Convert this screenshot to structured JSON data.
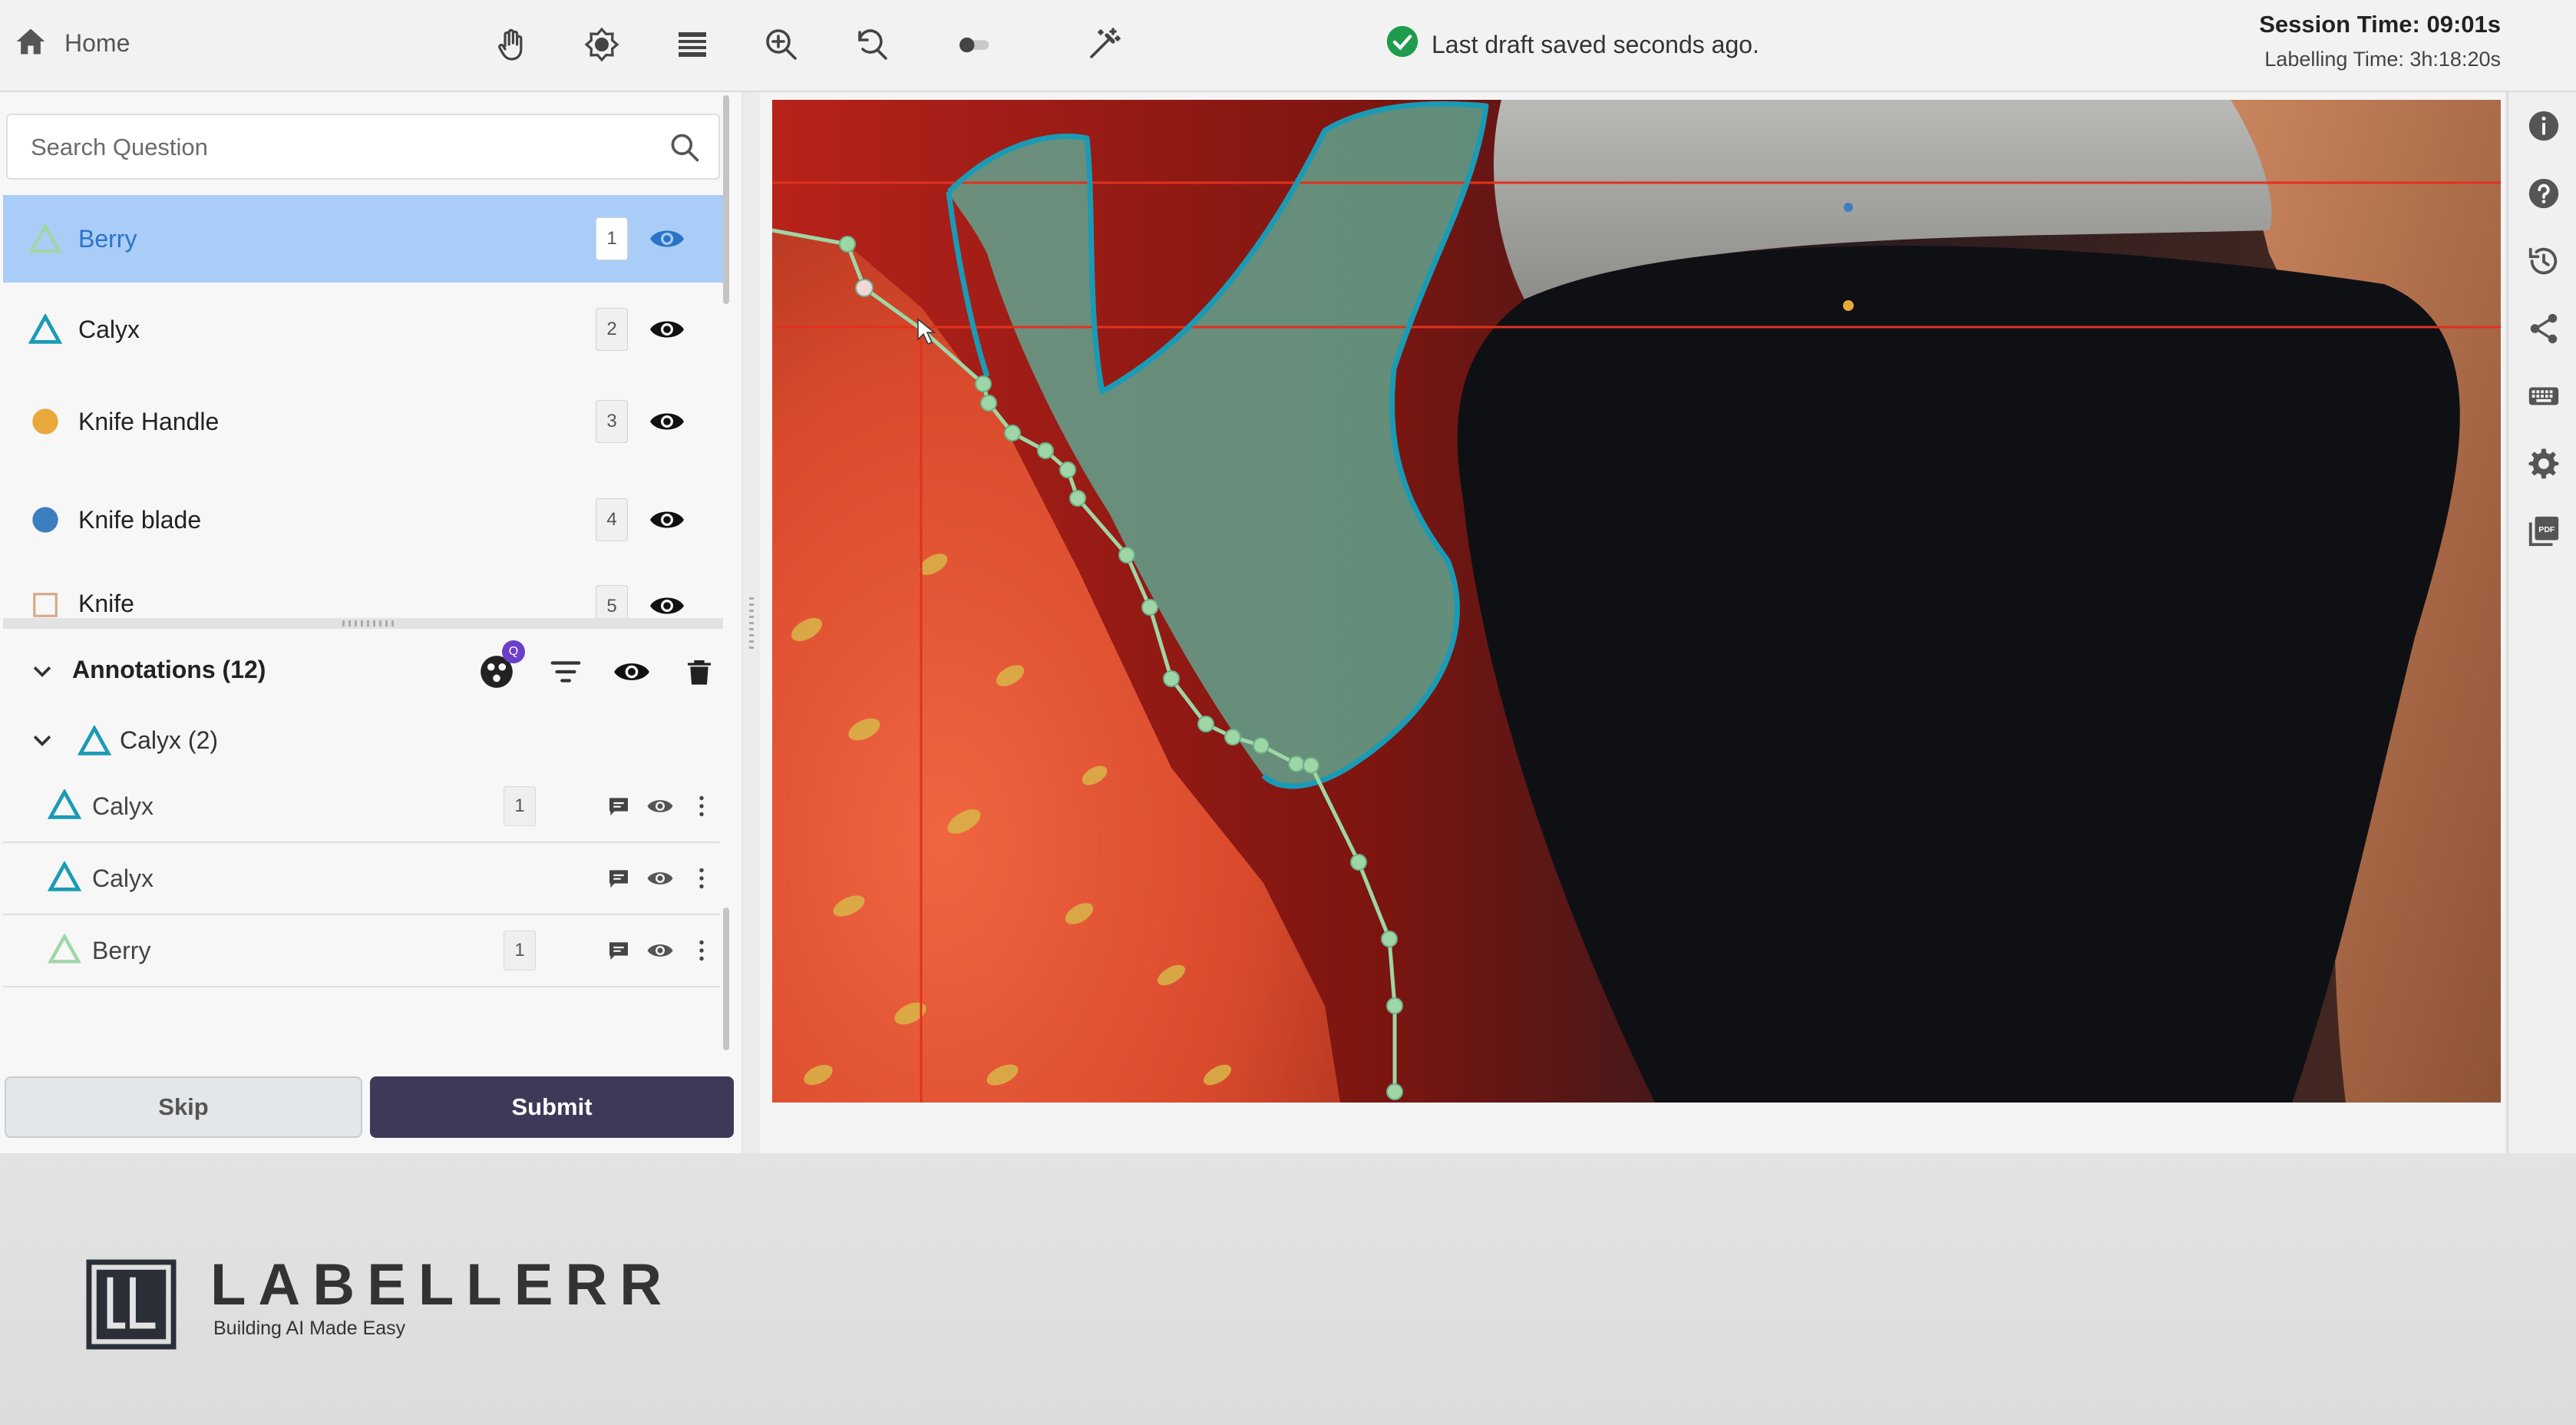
{
  "header": {
    "home_label": "Home",
    "draft_status": "Last draft saved seconds ago.",
    "session_time": "Session Time: 09:01s",
    "labelling_time": "Labelling Time: 3h:18:20s",
    "tools": [
      "pan-hand-icon",
      "brightness-icon",
      "layers-icon",
      "zoom-in-icon",
      "zoom-reset-icon",
      "toggle-switch",
      "magic-wand-icon"
    ]
  },
  "search": {
    "placeholder": "Search Question"
  },
  "classes": [
    {
      "label": "Berry",
      "hotkey": "1",
      "shape": "polygon",
      "color": "#9fd6a6",
      "selected": true
    },
    {
      "label": "Calyx",
      "hotkey": "2",
      "shape": "polygon",
      "color": "#1a9bb5",
      "selected": false
    },
    {
      "label": "Knife Handle",
      "hotkey": "3",
      "shape": "dot",
      "color": "#e8a83a",
      "selected": false
    },
    {
      "label": "Knife blade",
      "hotkey": "4",
      "shape": "dot",
      "color": "#3d7ec0",
      "selected": false
    },
    {
      "label": "Knife",
      "hotkey": "5",
      "shape": "box",
      "color": "#d6a98b",
      "selected": false
    }
  ],
  "annotations": {
    "title": "Annotations (12)",
    "ai_badge": "Q",
    "group_label": "Calyx (2)",
    "items": [
      {
        "label": "Calyx",
        "num": "1",
        "color": "#1a9bb5"
      },
      {
        "label": "Calyx",
        "num": "",
        "color": "#1a9bb5"
      },
      {
        "label": "Berry",
        "num": "1",
        "color": "#9fd6a6"
      }
    ]
  },
  "buttons": {
    "skip": "Skip",
    "submit": "Submit"
  },
  "colors": {
    "accent": "#3d3a59",
    "selected_row": "#a9cdf6",
    "saved_check": "#1e9b4c",
    "crosshair": "#e0321e"
  },
  "right_toolbar": [
    "info-icon",
    "help-icon",
    "history-icon",
    "share-icon",
    "keyboard-icon",
    "settings-icon",
    "pdf-icon"
  ],
  "brand": {
    "name": "LABELLERR",
    "tagline": "Building AI Made Easy"
  }
}
